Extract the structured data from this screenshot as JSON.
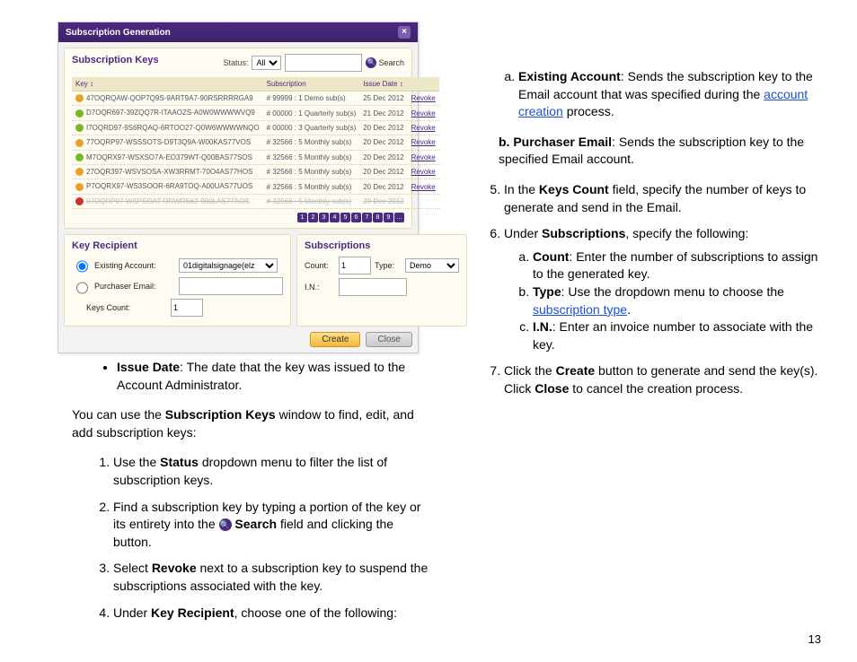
{
  "window": {
    "title": "Subscription Generation",
    "close_glyph": "×",
    "panel_title": "Subscription Keys",
    "status_label": "Status:",
    "status_value": "All",
    "search_label": "Search",
    "cols": {
      "key": "Key ↕",
      "sub": "Subscription",
      "issue": "Issue Date ↕"
    },
    "revoke_label": "Revoke",
    "rows": [
      {
        "icon": "orange",
        "key": "47OQRQAW-QOP7Q9S-9ART9A7-90RSRRRRGA9",
        "sub": "# 99999 : 1 Demo sub(s)",
        "date": "25 Dec 2012"
      },
      {
        "icon": "green",
        "key": "D7OQR697-39ZQQ7R-ITAAOZS-A0W0WWWWVQ9",
        "sub": "# 00000 : 1 Quarterly sub(s)",
        "date": "21 Dec 2012"
      },
      {
        "icon": "green",
        "key": "I7OQRD97-9S6RQAQ-6RTOO27-Q0W6WWWWNQO",
        "sub": "# 00000 : 3 Quarterly sub(s)",
        "date": "20 Dec 2012"
      },
      {
        "icon": "orange",
        "key": "77OQRP97-WSSSOTS-D9T3Q9A-W00KAS77VOS",
        "sub": "# 32566 : 5 Monthly sub(s)",
        "date": "20 Dec 2012"
      },
      {
        "icon": "green",
        "key": "M7OQRX97-WSXSO7A-EO379WT-Q00BAS77SOS",
        "sub": "# 32566 : 5 Monthly sub(s)",
        "date": "20 Dec 2012"
      },
      {
        "icon": "orange",
        "key": "27OQR397-WSVSOSA-XW3RRMT-70O4AS77HOS",
        "sub": "# 32566 : 5 Monthly sub(s)",
        "date": "20 Dec 2012"
      },
      {
        "icon": "orange",
        "key": "P7OQRX97-WS3SOOR-6RA9TOQ-A00UAS77UOS",
        "sub": "# 32566 : 5 Monthly sub(s)",
        "date": "20 Dec 2012"
      },
      {
        "icon": "red",
        "key": "07OQRP97-WSPSOAT-RRWRS62-900LAS77AOS",
        "sub": "# 32566 : 5 Monthly sub(s)",
        "date": "20 Dec 2012",
        "revoked": true
      }
    ],
    "pager": [
      "1",
      "2",
      "3",
      "4",
      "5",
      "6",
      "7",
      "8",
      "9",
      "…"
    ],
    "recipient": {
      "title": "Key Recipient",
      "existing_label": "Existing Account:",
      "existing_value": "01digitalsignage(elz",
      "purchaser_label": "Purchaser Email:",
      "keyscount_label": "Keys Count:",
      "keyscount_value": "1"
    },
    "subs": {
      "title": "Subscriptions",
      "count_label": "Count:",
      "count_value": "1",
      "type_label": "Type:",
      "type_value": "Demo",
      "in_label": "I.N.:"
    },
    "buttons": {
      "create": "Create",
      "close": "Close"
    }
  },
  "doc": {
    "left": {
      "bullet": {
        "b": "Issue Date",
        "t": ": The date that the key was issued to the Account Administrator."
      },
      "intro1": "You can use the ",
      "intro_b": "Subscription Keys",
      "intro2": " window to find, edit, and add subscription keys:",
      "s1a": "Use the ",
      "s1b": "Status",
      "s1c": " dropdown menu to filter the list of subscription keys.",
      "s2a": "Find a subscription key by typing a portion of the key or its entirety into the ",
      "s2b": " Search",
      "s2c": " field and clicking the button.",
      "s3a": "Select ",
      "s3b": "Revoke",
      "s3c": " next to a subscription key to suspend the subscriptions associated with the key.",
      "s4a": "Under ",
      "s4b": "Key Recipient",
      "s4c": ", choose one of the following:"
    },
    "right": {
      "a_t": "Existing Account",
      "a_r": ": Sends the subscription key to the Email account that was specified during the ",
      "a_link": "account creation",
      "a_end": " process.",
      "b_t": "b.  Purchaser Email",
      "b_r": ": Sends the subscription key to the specified Email account.",
      "s5a": "In the ",
      "s5b": "Keys Count",
      "s5c": " field, specify the number of keys to generate and send in the Email.",
      "s6a": "Under ",
      "s6b": "Subscriptions",
      "s6c": ", specify the following:",
      "s6_a1": "Count",
      "s6_a2": ": Enter the number of subscriptions to assign to the generated key.",
      "s6_b1": "Type",
      "s6_b2": ": Use the dropdown menu to choose the ",
      "s6_b_link": "subscription type",
      "s6_b3": ".",
      "s6_c1": "I.N.",
      "s6_c2": ": Enter an invoice number to associate with the key.",
      "s7a": "Click the ",
      "s7b": "Create",
      "s7c": " button to generate and send the key(s). Click ",
      "s7d": "Close",
      "s7e": " to cancel the creation process."
    },
    "page_no": "13"
  }
}
